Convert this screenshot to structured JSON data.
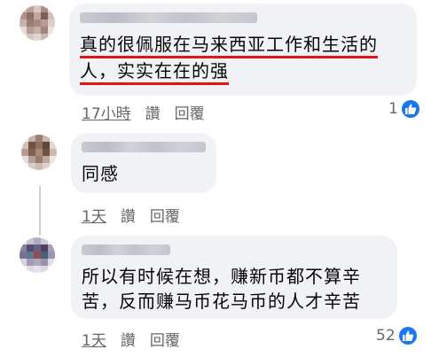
{
  "comments": [
    {
      "text_lines": [
        "真的很佩服在马来西亚工作和生活的",
        "人，实实在在的强"
      ],
      "time": "17小時",
      "like_label": "讚",
      "reply_label": "回覆",
      "reaction_count": "1"
    },
    {
      "text_lines": [
        "同感"
      ],
      "time": "1天",
      "like_label": "讚",
      "reply_label": "回覆",
      "reaction_count": ""
    },
    {
      "text_lines": [
        "所以有时候在想，赚新币都不算辛",
        "苦，反而赚马币花马币的人才辛苦"
      ],
      "time": "1天",
      "like_label": "讚",
      "reply_label": "回覆",
      "reaction_count": "52"
    }
  ],
  "colors": {
    "bubble": "#f0f2f5",
    "meta_text": "#65676b",
    "underline": "#e21414",
    "like": "#1877f2"
  },
  "icons": {
    "reaction": "thumbs-up-icon"
  }
}
